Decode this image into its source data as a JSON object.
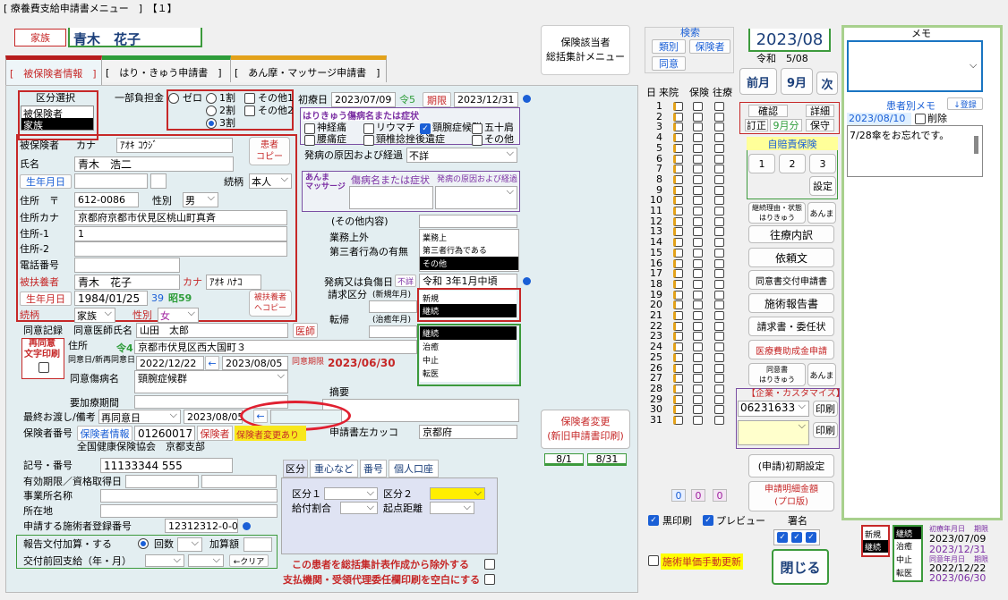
{
  "window": {
    "title": "[ 療養費支給申請書メニュー　]　【１】"
  },
  "header": {
    "relation_label": "家族",
    "patient_name": "青木　花子",
    "insurer_menu": "保険該当者\n総括集計メニュー"
  },
  "tabs": [
    "[　被保険者情報　]",
    "[　はり・きゅう申請書　]",
    "[　あん摩・マッサージ申請書　]"
  ],
  "kubun": {
    "title": "区分選択",
    "options": [
      "被保険者",
      "家族"
    ],
    "selected": 1
  },
  "futan": {
    "label": "一部負担金",
    "options": [
      "ゼロ",
      "1割",
      "2割",
      "3割"
    ],
    "selected": 3,
    "checks": [
      "その他1",
      "その他2"
    ]
  },
  "insured": {
    "kana_label": "カナ",
    "kana": "ｱｵｷ ｺｳｼﾞ",
    "name_label": "氏名",
    "name": "青木　浩二",
    "label": "被保険者",
    "copy_btn": "患者\nコピー",
    "birth_btn": "生年月日",
    "relation_label": "続柄",
    "relation": "本人",
    "zip_label": "住所　〒",
    "zip": "612-0086",
    "sex_label": "性別",
    "sex": "男",
    "addr_kana_label": "住所カナ",
    "addr_kana": "京都府京都市伏見区桃山町真斉",
    "addr1_label": "住所-1",
    "addr1": "1",
    "addr2_label": "住所-2",
    "addr2": "",
    "phone_label": "電話番号",
    "phone": ""
  },
  "patient": {
    "label": "被扶養者",
    "name": "青木　花子",
    "kana_label": "カナ",
    "kana": "ｱｵｷ ﾊﾅｺ",
    "birth_btn": "生年月日",
    "birth": "1984/01/25",
    "age": "39",
    "era": "昭59",
    "relation_label": "続柄",
    "relation": "家族",
    "sex_label": "性別",
    "sex": "女",
    "copy_btn": "被扶養者\nへコピー"
  },
  "treatment": {
    "first_label": "初療日",
    "first": "2023/07/09",
    "count": "令5",
    "period_label": "期限",
    "period": "2023/12/31",
    "harikyu_label": "はりきゅう傷病名または症状",
    "diseases": [
      {
        "l": "神経痛",
        "c": false
      },
      {
        "l": "リウマチ",
        "c": false
      },
      {
        "l": "頸腕症候群",
        "c": true
      },
      {
        "l": "五十肩",
        "c": false
      },
      {
        "l": "腰痛症",
        "c": false
      },
      {
        "l": "頸椎捻挫後遺症",
        "c": false
      },
      {
        "l": "その他",
        "c": false
      }
    ],
    "cause_label": "発病の原因および経過",
    "cause": "不詳",
    "anma_label": "あんま\nマッサージ",
    "anma_disease_label": "傷病名または症状",
    "anma_cause_label": "発病の原因および経過",
    "other_label": "(その他内容)",
    "work_label": "業務上外",
    "third_label": "第三者行為の有無",
    "work_opts": [
      "業務上",
      "第三者行為である",
      "その他"
    ],
    "onset_label": "発病又は負傷日",
    "unknown_label": "不詳",
    "onset": "令和 3年1月中頃",
    "claim_label": "請求区分",
    "claim_sub": "(新規年月)",
    "claim_opts": [
      "新規",
      "継続"
    ],
    "tenki_label": "転帰",
    "tenki_sub": "(治癒年月)",
    "tenki_opts": [
      "継続",
      "治癒",
      "中止",
      "転医"
    ]
  },
  "doctor": {
    "rec_label": "同意記録",
    "doc_label": "同意医師氏名",
    "doc": "山田　太郎",
    "doc_btn": "医師",
    "reprint": "再同意\n文字印刷",
    "addr_label": "住所",
    "addr_era": "令4",
    "addr": "京都市伏見区西大国町３",
    "date_label": "同意日/新再同意日",
    "date1": "2022/12/22",
    "date2": "2023/08/05",
    "limit_label": "同意期限",
    "limit": "2023/06/30",
    "disease_label": "同意傷病名",
    "disease": "頸腕症候群",
    "need_label": "要加療期間",
    "last_label": "最終お渡し/備考",
    "last_sel": "再同意日",
    "last_date": "2023/08/05",
    "summary_label": "摘要"
  },
  "insurer": {
    "num_label": "保険者番号",
    "info_btn": "保険者情報",
    "num": "01260017",
    "tag": "保険者",
    "change_tag": "保険者変更あり",
    "name": "全国健康保険協会　京都支部",
    "kakko_label": "申請書左カッコ",
    "kakko": "京都府",
    "kigo_label": "記号・番号",
    "kigo": "11133344 555",
    "valid_label": "有効期限／資格取得日",
    "office_label": "事業所名称",
    "loc_label": "所在地",
    "reg_label": "申請する施術者登録番号",
    "reg": "12312312-0-0",
    "report_label": "報告文付加算・する",
    "times_label": "回数",
    "add_label": "加算額",
    "prev_label": "交付前回支給（年・月）",
    "clear_btn": "←クリア"
  },
  "subtabs": [
    "区分",
    "重心など",
    "番号",
    "個人口座"
  ],
  "subpanel": {
    "k1": "区分１",
    "k2": "区分２",
    "pay": "給付割合",
    "start": "起点距離"
  },
  "bottom": {
    "exclude": "この患者を総括集計表作成から除外する",
    "blank": "支払機関・受領代理委任欄印刷を空白にする"
  },
  "change_btn": "保険者変更\n(新旧申請書印刷)",
  "dates_btn": [
    "8/1",
    "8/31"
  ],
  "search": {
    "title": "検索",
    "btns": [
      "類別",
      "保険者",
      "同意"
    ]
  },
  "month": {
    "ym": "2023/08",
    "era": "令和　5/08",
    "prev": "前月",
    "m": "9月",
    "next": "次"
  },
  "calendar": {
    "head": [
      "日",
      "来院",
      "保険",
      "往療"
    ],
    "days": [
      "1",
      "2",
      "3",
      "4",
      "5",
      "6",
      "7",
      "8",
      "9",
      "10",
      "11",
      "12",
      "13",
      "14",
      "15",
      "16",
      "17",
      "18",
      "19",
      "20",
      "21",
      "22",
      "23",
      "24",
      "25",
      "26",
      "27",
      "28",
      "29",
      "30",
      "31"
    ],
    "totals": [
      "0",
      "0",
      "0"
    ]
  },
  "kakunin": {
    "b1": "確認",
    "b2": "詳細",
    "b3": "訂正",
    "b4": "9月分",
    "b5": "保守"
  },
  "jibai": {
    "title": "自賠責保険",
    "nums": [
      "1",
      "2",
      "3"
    ],
    "setting": "設定"
  },
  "right_btns": {
    "reason": "継続理由・状態\nはりきゅう",
    "anma": "あんま",
    "ouryo": "往療内訳",
    "irai": "依頼文",
    "douisho": "同意書交付申請書",
    "sejutsu": "施術報告書",
    "seikyu": "請求書・委任状",
    "iryohi": "医療費助成金申請",
    "dui": "同意書\nはりきゅう",
    "anma2": "あんま"
  },
  "custom": {
    "title": "【企業・カスタマイズ】",
    "code": "06231633",
    "print": "印刷"
  },
  "rb2": {
    "initial": "(申請)初期設定",
    "meisai": "申請明細金額\n(プロ版)"
  },
  "print": {
    "black": "黒印刷",
    "preview": "プレビュー",
    "sign": "署名"
  },
  "manual": "施術単価手動更新",
  "close": "閉じる",
  "memo": {
    "title": "メモ",
    "patient_title": "患者別メモ",
    "register": "↓登録",
    "date": "2023/08/10",
    "delete": "削除",
    "text": "7/28傘をお忘れです。"
  },
  "status": {
    "a": [
      "新規",
      "継続"
    ],
    "b": [
      "継続",
      "治癒",
      "中止",
      "転医"
    ],
    "first_label": "初療年月日",
    "period_label": "期限",
    "first": "2023/07/09",
    "period": "2023/12/31",
    "dui_label": "同意年月日",
    "dui_period": "期限",
    "dui": "2022/12/22",
    "dui_end": "2023/06/30"
  }
}
